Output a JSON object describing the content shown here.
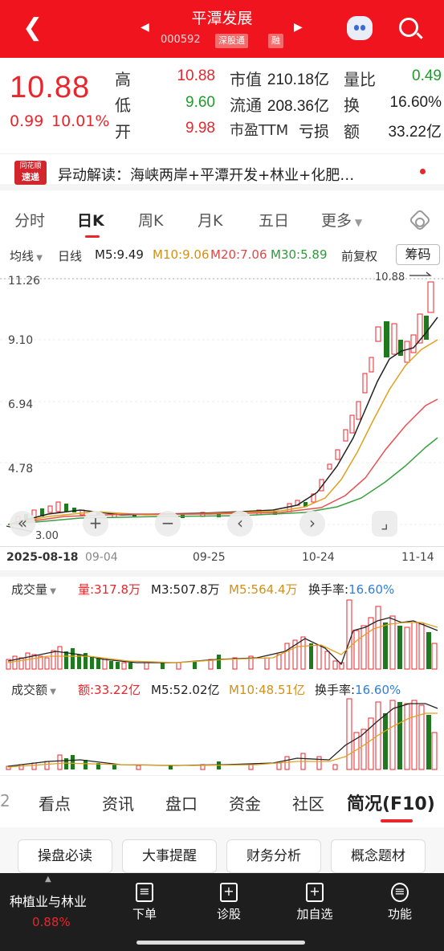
{
  "header": {
    "title": "平潭发展",
    "code": "000592",
    "tag1": "深股通",
    "tag2": "融"
  },
  "quote": {
    "price": "10.88",
    "chg": "0.99",
    "pct": "10.01%",
    "high_l": "高",
    "high": "10.88",
    "low_l": "低",
    "low": "9.60",
    "open_l": "开",
    "open": "9.98",
    "mcap_l": "市值",
    "mcap": "210.18亿",
    "float_l": "流通",
    "float": "208.36亿",
    "pe_l": "市盈TTM",
    "pe": "亏损",
    "vr_l": "量比",
    "vr": "0.49",
    "to_l": "换",
    "to": "16.60%",
    "amt_l": "额",
    "amt": "33.22亿"
  },
  "news": {
    "logo1": "同花顺",
    "logo2": "速递",
    "text": "异动解读：海峡两岸+平潭开发+林业+化肥…"
  },
  "tabs": [
    "分时",
    "日K",
    "周K",
    "月K",
    "五日",
    "更多"
  ],
  "sub": {
    "ma": "均线",
    "period": "日线",
    "m5": "M5:9.49",
    "m10": "M10:9.06",
    "m20": "M20:7.06",
    "m30": "M30:5.89",
    "adj": "前复权",
    "chip": "筹码"
  },
  "axis": {
    "y1": "11.26",
    "y2": "9.10",
    "y3": "6.94",
    "y4": "4.78",
    "low": "3.00",
    "hi": "10.88",
    "d1": "2025-08-18",
    "d2": "09-04",
    "d3": "09-25",
    "d4": "10-24",
    "d5": "11-14"
  },
  "vol": {
    "name": "成交量",
    "v": "量:317.8万",
    "m3": "M3:507.8万",
    "m5": "M5:564.4万",
    "to": "换手率:",
    "tov": "16.60%"
  },
  "amt": {
    "name": "成交额",
    "v": "额:33.22亿",
    "m5": "M5:52.02亿",
    "m10": "M10:48.51亿",
    "to": "换手率:",
    "tov": "16.60%"
  },
  "bottom_tabs": [
    "2",
    "看点",
    "资讯",
    "盘口",
    "资金",
    "社区",
    "简况(F10)"
  ],
  "buttons": [
    "操盘必读",
    "大事提醒",
    "财务分析",
    "概念题材"
  ],
  "footer": {
    "sector": "种植业与林业",
    "sector_pct": "0.88%",
    "b1": "下单",
    "b2": "诊股",
    "b3": "加自选",
    "b4": "功能"
  },
  "colors": {
    "up": "#e8262c",
    "down": "#1f7a1f",
    "m5": "#222222",
    "m10": "#e0a020",
    "m20": "#e85050",
    "m30": "#3aa040"
  }
}
